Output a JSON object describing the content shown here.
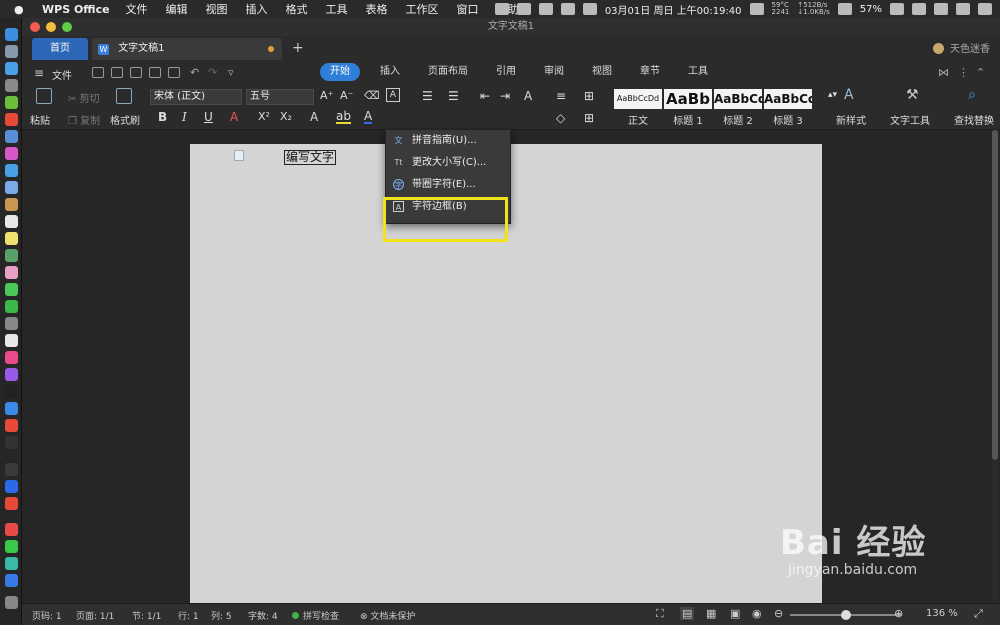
{
  "menubar": {
    "app_name": "WPS Office",
    "items": [
      "文件",
      "编辑",
      "视图",
      "插入",
      "格式",
      "工具",
      "表格",
      "工作区",
      "窗口",
      "帮助"
    ],
    "temp": "59°C",
    "net_up": "↑512B/s",
    "rpm": "2241",
    "net_down": "↓1.0KB/s",
    "datetime": "03月01日 周日 上午00:19:40",
    "battery": "57%"
  },
  "window": {
    "title": "文字文稿1",
    "tab_home": "首页",
    "tab_doc": "文字文稿1",
    "tab_add": "+",
    "user_name": "天色迷香"
  },
  "toolbar": {
    "file_label": "文件",
    "ribbon_tabs": [
      "开始",
      "插入",
      "页面布局",
      "引用",
      "审阅",
      "视图",
      "章节",
      "工具"
    ]
  },
  "ribbon": {
    "paste": "粘贴",
    "cut": "剪切",
    "copy": "复制",
    "format_painter": "格式刷",
    "font_name": "宋体 (正文)",
    "font_size": "五号",
    "styles": [
      {
        "preview": "AaBbCcDd",
        "name": "正文"
      },
      {
        "preview": "AaBb",
        "name": "标题 1"
      },
      {
        "preview": "AaBbCc",
        "name": "标题 2"
      },
      {
        "preview": "AaBbCc",
        "name": "标题 3"
      }
    ],
    "new_style": "新样式",
    "text_tools": "文字工具",
    "find_replace": "查找替换"
  },
  "dropdown": {
    "items": [
      "拼音指南(U)...",
      "更改大小写(C)...",
      "带圈字符(E)...",
      "字符边框(B)"
    ]
  },
  "document": {
    "text": "编写文字"
  },
  "statusbar": {
    "page_code": "页码: 1",
    "pages": "页面: 1/1",
    "section": "节: 1/1",
    "row": "行: 1",
    "col": "列: 5",
    "word_count": "字数: 4",
    "spell_check": "拼写检查",
    "doc_protect": "文档未保护",
    "zoom": "136 %"
  },
  "zoom_level": 0.5,
  "watermark": {
    "brand": "Bai 经验",
    "url": "jingyan.baidu.com"
  },
  "colors": {
    "accent": "#2f7fd8",
    "highlight": "#f2e21a",
    "tab_home": "#2d67b8"
  }
}
